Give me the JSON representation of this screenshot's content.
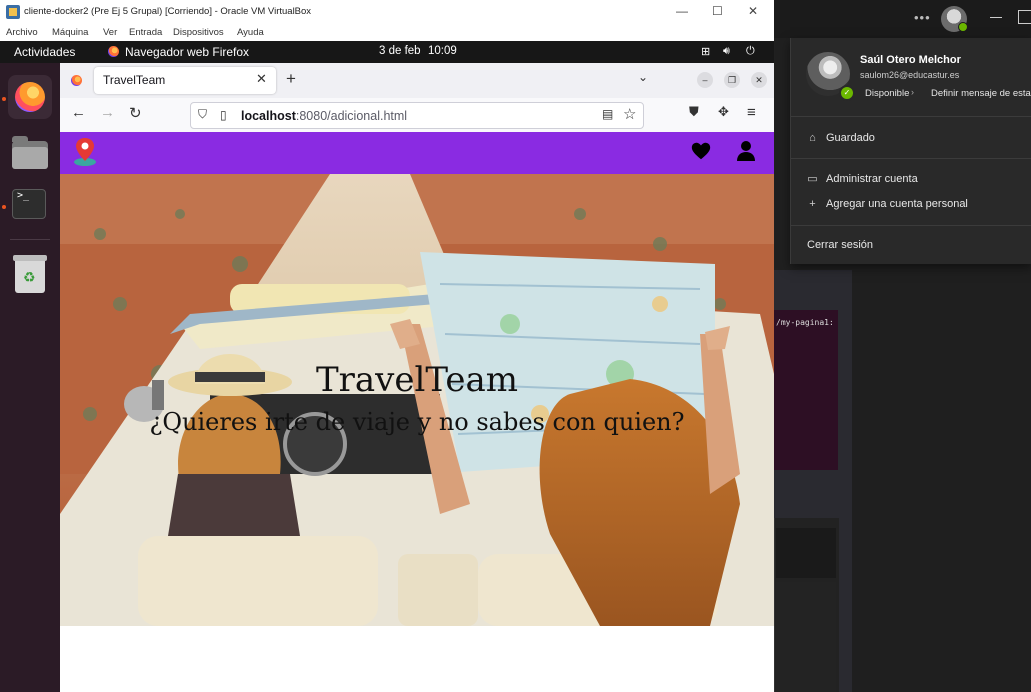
{
  "host": {
    "profile": {
      "name": "Saúl Otero Melchor",
      "email": "saulom26@educastur.es",
      "availability": "Disponible",
      "status_message_action": "Definir mensaje de estado",
      "menu": {
        "saved": "Guardado",
        "manage_account": "Administrar cuenta",
        "add_personal_account": "Agregar una cuenta personal",
        "sign_out": "Cerrar sesión"
      }
    },
    "terminal_snippet": "/my-pagina1:",
    "status_color": "#6bb700"
  },
  "vbox": {
    "title": "cliente-docker2 (Pre Ej 5 Grupal) [Corriendo] - Oracle VM VirtualBox",
    "menu": [
      "Archivo",
      "Máquina",
      "Ver",
      "Entrada",
      "Dispositivos",
      "Ayuda"
    ]
  },
  "gnome": {
    "activities": "Actividades",
    "app_name": "Navegador web Firefox",
    "date": "3 de feb",
    "time": "10:09",
    "accent": "#e95420"
  },
  "firefox": {
    "tab_title": "TravelTeam",
    "url_host": "localhost",
    "url_rest": ":8080/adicional.html"
  },
  "site": {
    "nav_color": "#8a2be2",
    "hero_title": "TravelTeam",
    "hero_subtitle": "¿Quieres irte de viaje y no sabes con quien?"
  }
}
